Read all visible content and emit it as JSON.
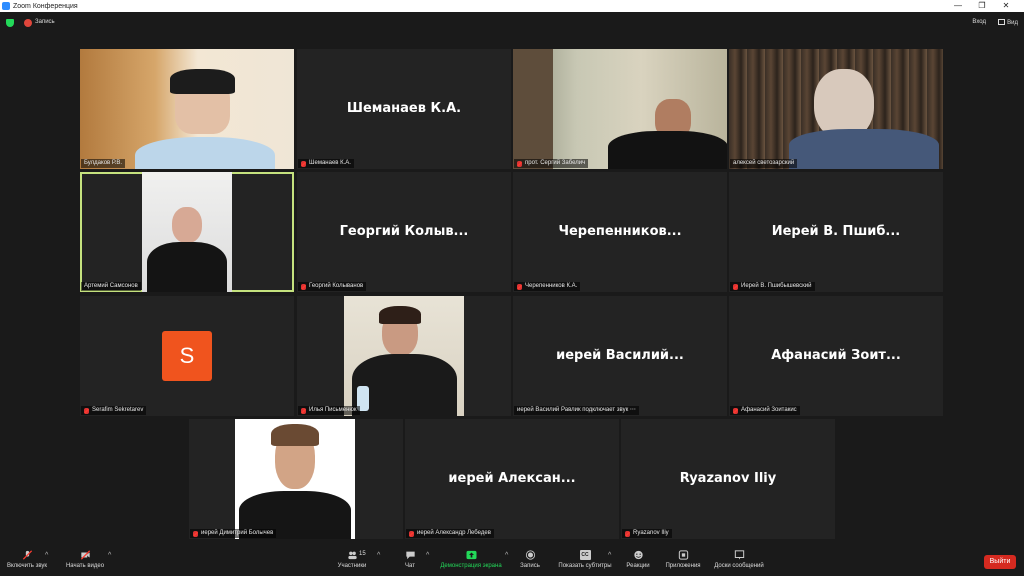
{
  "window": {
    "title": "Zoom Конференция",
    "controls": [
      "—",
      "❐",
      "✕"
    ]
  },
  "topbar": {
    "recording_label": "Запись",
    "signin_label": "Вход",
    "view_label": "Вид"
  },
  "tiles": [
    {
      "label": "Булдаков Р.В.",
      "big": "",
      "muted": false
    },
    {
      "label": "Шеманаев К.А.",
      "big": "Шеманаев К.А.",
      "muted": true
    },
    {
      "label": "прот. Сергий Забелич",
      "big": "",
      "muted": true
    },
    {
      "label": "алексей светозарский",
      "big": "",
      "muted": false
    },
    {
      "label": "Артемий Самсонов",
      "big": "",
      "muted": false
    },
    {
      "label": "Георгий Колыванов",
      "big": "Георгий Колыв...",
      "muted": true
    },
    {
      "label": "Черепенников К.А.",
      "big": "Черепенников...",
      "muted": true
    },
    {
      "label": "Иерей В. Пшибышевский",
      "big": "Иерей В. Пшиб...",
      "muted": true
    },
    {
      "label": "Serafim Sekretarev",
      "big": "",
      "avatar": "S",
      "muted": true
    },
    {
      "label": "Илья Письменюк",
      "big": "",
      "muted": true
    },
    {
      "label": "иерей Василий Равлик подключает звук ⋯",
      "big": "иерей Василий...",
      "muted": false
    },
    {
      "label": "Афанасий Зоитакис",
      "big": "Афанасий Зоит...",
      "muted": true
    },
    {
      "label": "иерей Димитрий Болычев",
      "big": "",
      "muted": true
    },
    {
      "label": "иерей Александр Лебедев",
      "big": "иерей Алексан...",
      "muted": true
    },
    {
      "label": "Ryazanov Iliy",
      "big": "Ryazanov Iliy",
      "muted": true
    }
  ],
  "toolbar": {
    "audio": "Включить звук",
    "video": "Начать видео",
    "participants": "Участники",
    "participants_count": "15",
    "chat": "Чат",
    "share": "Демонстрация экрана",
    "record": "Запись",
    "captions": "Показать субтитры",
    "captions_badge": "CC",
    "reactions": "Реакции",
    "apps": "Приложения",
    "whiteboards": "Доски сообщений",
    "leave": "Выйти"
  },
  "colors": {
    "accent": "#2d8cff",
    "share_green": "#23d959",
    "leave_red": "#d52a20",
    "active_speaker": "#c5e27e",
    "avatar_orange": "#f0541e"
  }
}
